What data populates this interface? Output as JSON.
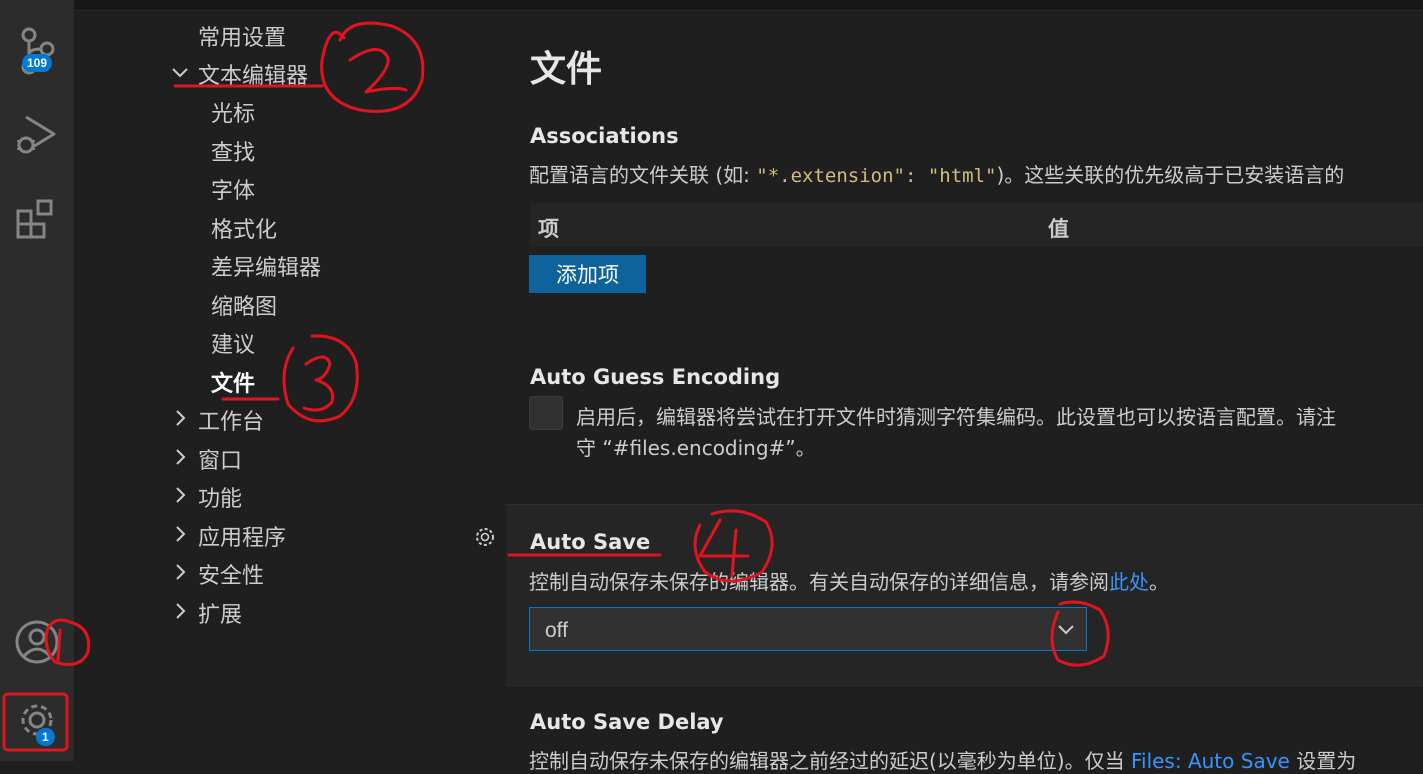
{
  "activity_bar": {
    "source_control_badge": "109",
    "settings_badge": "1"
  },
  "toc": {
    "items": [
      {
        "label": "常用设置"
      },
      {
        "label": "文本编辑器"
      },
      {
        "label": "光标"
      },
      {
        "label": "查找"
      },
      {
        "label": "字体"
      },
      {
        "label": "格式化"
      },
      {
        "label": "差异编辑器"
      },
      {
        "label": "缩略图"
      },
      {
        "label": "建议"
      },
      {
        "label": "文件"
      },
      {
        "label": "工作台"
      },
      {
        "label": "窗口"
      },
      {
        "label": "功能"
      },
      {
        "label": "应用程序"
      },
      {
        "label": "安全性"
      },
      {
        "label": "扩展"
      }
    ]
  },
  "main": {
    "section_title": "文件",
    "associations": {
      "title": "Associations",
      "desc_before": "配置语言的文件关联 (如: ",
      "desc_code": "\"*.extension\": \"html\"",
      "desc_after": ")。这些关联的优先级高于已安装语言的",
      "col_item": "项",
      "col_value": "值",
      "add_button": "添加项"
    },
    "auto_guess": {
      "title": "Auto Guess Encoding",
      "desc_line1": "启用后，编辑器将尝试在打开文件时猜测字符集编码。此设置也可以按语言配置。请注",
      "desc_line2": "守 “#files.encoding#”。",
      "checked": false
    },
    "auto_save": {
      "title": "Auto Save",
      "desc": "控制自动保存未保存的编辑器。有关自动保存的详细信息，请参阅",
      "link": "此处",
      "desc_end": "。",
      "value": "off"
    },
    "auto_save_delay": {
      "title": "Auto Save Delay",
      "desc": "控制自动保存未保存的编辑器之前经过的延迟(以毫秒为单位)。仅当 ",
      "link": "Files: Auto Save",
      "desc_end": " 设置为"
    }
  },
  "annotations": {
    "n1": "1",
    "n2": "2",
    "n3": "3",
    "n4": "4"
  },
  "colors": {
    "accent": "#0078d4",
    "button": "#0e639c",
    "annotation": "#e0141e"
  }
}
